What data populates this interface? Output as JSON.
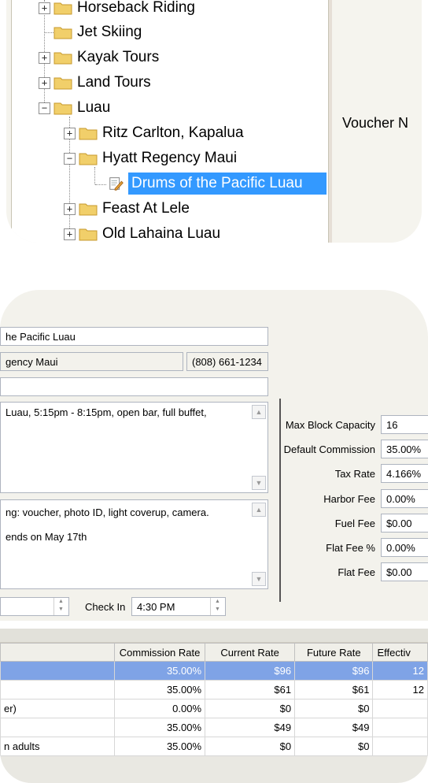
{
  "tree": {
    "nodes": [
      {
        "label": "Horseback Riding",
        "expander": "+"
      },
      {
        "label": "Jet Skiing",
        "expander": ""
      },
      {
        "label": "Kayak Tours",
        "expander": "+"
      },
      {
        "label": "Land Tours",
        "expander": "+"
      },
      {
        "label": "Luau",
        "expander": "−"
      },
      {
        "label": "Ritz Carlton, Kapalua",
        "expander": "+"
      },
      {
        "label": "Hyatt Regency Maui",
        "expander": "−"
      },
      {
        "label": "Drums of the Pacific Luau",
        "expander": ""
      },
      {
        "label": "Feast At Lele",
        "expander": "+"
      },
      {
        "label": "Old Lahaina Luau",
        "expander": "+"
      }
    ],
    "side_label": "Voucher N"
  },
  "form": {
    "name_value": "he Pacific Luau",
    "venue_value": "gency Maui",
    "phone_value": "(808) 661-1234",
    "description_lines": [
      "Luau, 5:15pm - 8:15pm, open bar, full buffet,"
    ],
    "notes_lines": [
      "ng: voucher, photo ID, light coverup, camera.",
      " ends on May 17th"
    ],
    "checkin_label": "Check In",
    "checkin_value": "4:30 PM",
    "rates": [
      {
        "label": "Max Block Capacity",
        "value": "16"
      },
      {
        "label": "Default Commission",
        "value": "35.00%"
      },
      {
        "label": "Tax Rate",
        "value": "4.166%"
      },
      {
        "label": "Harbor Fee",
        "value": "0.00%"
      },
      {
        "label": "Fuel Fee",
        "value": "$0.00"
      },
      {
        "label": "Flat Fee %",
        "value": "0.00%"
      },
      {
        "label": "Flat Fee",
        "value": "$0.00"
      }
    ]
  },
  "grid": {
    "columns": [
      "",
      "Commission Rate",
      "Current Rate",
      "Future Rate",
      "Effectiv"
    ],
    "rows": [
      {
        "name": "",
        "commission": "35.00%",
        "current": "$96",
        "future": "$96",
        "effective": "12"
      },
      {
        "name": "",
        "commission": "35.00%",
        "current": "$61",
        "future": "$61",
        "effective": "12"
      },
      {
        "name": "er)",
        "commission": "0.00%",
        "current": "$0",
        "future": "$0",
        "effective": ""
      },
      {
        "name": "",
        "commission": "35.00%",
        "current": "$49",
        "future": "$49",
        "effective": ""
      },
      {
        "name": "n adults",
        "commission": "35.00%",
        "current": "$0",
        "future": "$0",
        "effective": ""
      }
    ]
  }
}
